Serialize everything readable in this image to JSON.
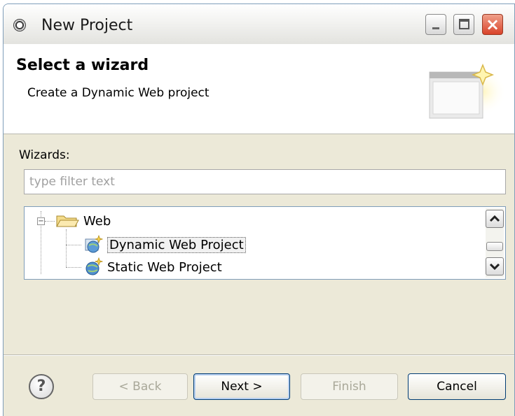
{
  "window": {
    "title": "New Project"
  },
  "banner": {
    "title": "Select a wizard",
    "description": "Create a Dynamic Web project"
  },
  "wizards_label": "Wizards:",
  "filter": {
    "placeholder": "type filter text",
    "value": ""
  },
  "tree": {
    "category": {
      "label": "Web",
      "expanded": true
    },
    "items": [
      {
        "label": "Dynamic Web Project",
        "selected": true
      },
      {
        "label": "Static Web Project",
        "selected": false
      }
    ]
  },
  "buttons": {
    "help": "?",
    "back": "< Back",
    "next": "Next >",
    "finish": "Finish",
    "cancel": "Cancel"
  },
  "colors": {
    "selection_border": "#555555",
    "window_bg": "#ece9d8",
    "close_button": "#d9432a"
  }
}
